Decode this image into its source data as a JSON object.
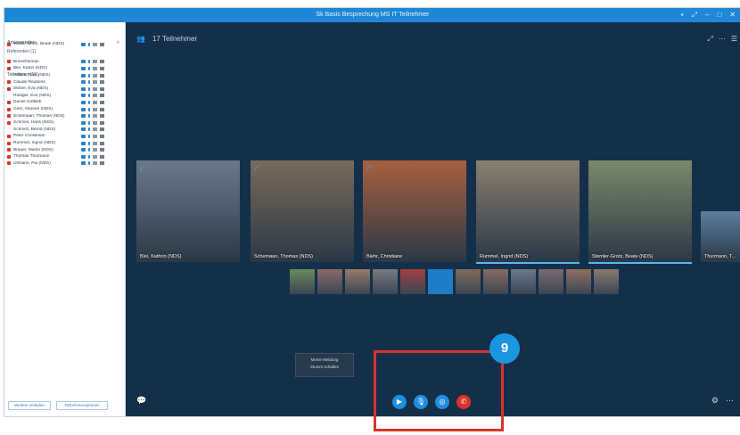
{
  "window": {
    "title": "Sk Basis Besprechung MS IT Teilnehmer",
    "controls": [
      "▪",
      "⤢",
      "–",
      "□",
      "✕"
    ]
  },
  "sidebar": {
    "header": "Anwesenden",
    "collapse": "˄",
    "section_presenters": "Referenten (1)",
    "section_attendees": "Teilnehmer (16)",
    "rows": [
      {
        "name": "Wader-Grotz, Beate (NDS)",
        "red": true,
        "mic": "muted"
      },
      {
        "name": "Bries/Rieman",
        "red": true
      },
      {
        "name": "Blei, Katrin (NDS)",
        "red": true
      },
      {
        "name": "Hillack, Rike (NDS)",
        "red": false
      },
      {
        "name": "Claude Reubens",
        "red": true
      },
      {
        "name": "Stebel, Eva (NDS)",
        "red": true
      },
      {
        "name": "Rüdiger, Eva (NDS)",
        "red": false
      },
      {
        "name": "Daniel Gottlieb",
        "red": true
      },
      {
        "name": "Gehr, Mareen (NDS)",
        "red": true
      },
      {
        "name": "Schemaan, Thomas (NDS)",
        "red": true
      },
      {
        "name": "Schmiel, Hans (NDS)",
        "red": true
      },
      {
        "name": "Schmitz, Bernd (NDS)",
        "red": false
      },
      {
        "name": "Peter Christinian",
        "red": true
      },
      {
        "name": "Rummel, Ingrid (NDS)",
        "red": true
      },
      {
        "name": "Brauer, Martin (NDS)",
        "red": true
      },
      {
        "name": "Thomas Thurmann",
        "red": true,
        "mic": "muted"
      },
      {
        "name": "Ullmann, Pia (NDS)",
        "red": true
      }
    ],
    "btn_left": "Weitere einladen",
    "btn_right": "Teilnehmeroptionen"
  },
  "main": {
    "header_icon": "👥",
    "participants_label": "17 Teilnehmer",
    "header_right": [
      "⤢",
      "⋯",
      "☰"
    ],
    "tiles": [
      {
        "name": "Blei, Kathrin (NDS)",
        "color": "#6b7a8a",
        "badge": true
      },
      {
        "name": "Schemaan, Thomas (NDS)",
        "color": "#7a6a5a",
        "badge": true
      },
      {
        "name": "Biehr, Christiane",
        "color": "#a86040",
        "badge": true
      },
      {
        "name": "Rummel, Ingrid (NDS)",
        "color": "#8a8070",
        "badge": false,
        "active": true
      },
      {
        "name": "Stemler-Grotz, Beate (NDS)",
        "color": "#7a8a6a",
        "badge": false,
        "active": true
      },
      {
        "name": "Thurmann, T...",
        "color": "#5c7fa0",
        "badge": false
      }
    ],
    "thumbnails": [
      "#6a8a5a",
      "#8a6a6a",
      "#9a7a6a",
      "#7a7a80",
      "#a04040",
      "",
      "#806a5a",
      "#8a6a60",
      "#6a7a8a",
      "#7a6a70",
      "#907060",
      "#8a7a70"
    ],
    "popup": {
      "line1": "Meine Meldung",
      "line2": "Stumm schalten"
    },
    "controls": {
      "video": "▶",
      "mic": "🎙",
      "share": "◎",
      "hangup": "✆"
    },
    "bottom_left_icon": "💬",
    "bottom_right_icons": [
      "⚙",
      "⋯"
    ]
  },
  "annotation": {
    "number": "9"
  }
}
